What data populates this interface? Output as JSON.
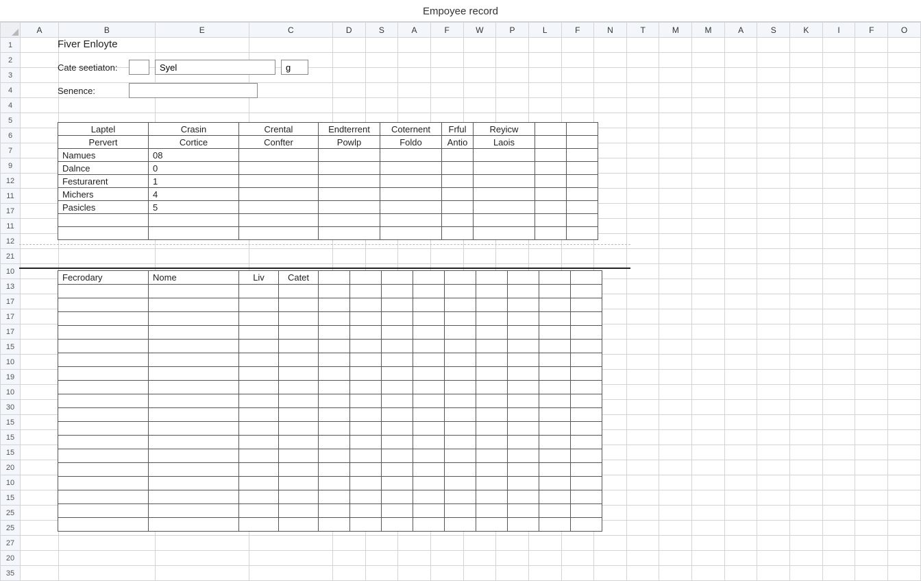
{
  "window": {
    "title": "Empoyee record"
  },
  "columns": [
    "A",
    "B",
    "E",
    "C",
    "D",
    "S",
    "A",
    "F",
    "W",
    "P",
    "L",
    "F",
    "N",
    "T",
    "M",
    "M",
    "A",
    "S",
    "K",
    "I",
    "F",
    "O"
  ],
  "row_numbers": [
    "1",
    "2",
    "3",
    "4",
    "4",
    "5",
    "6",
    "7",
    "9",
    "12",
    "11",
    "17",
    "11",
    "12",
    "21",
    "10",
    "13",
    "17",
    "17",
    "17",
    "15",
    "10",
    "19",
    "10",
    "30",
    "15",
    "15",
    "15",
    "20",
    "10",
    "15",
    "25",
    "25",
    "27",
    "20",
    "35"
  ],
  "form": {
    "title": "Fiver Enloyte",
    "label1": "Cate seetiaton:",
    "input1": "",
    "input2": "Syel",
    "input3": "g",
    "label2": "Senence:",
    "input4": ""
  },
  "table1": {
    "headers": [
      "Laptel",
      "Crasin",
      "Crental",
      "Endterrent",
      "Coternent",
      "Frful",
      "Reyicw",
      "",
      ""
    ],
    "sub": [
      "Pervert",
      "Cortice",
      "Confter",
      "Powlp",
      "Foldo",
      "Antio",
      "Laois",
      "",
      ""
    ],
    "rows": [
      [
        "Namues",
        "08",
        "",
        "",
        "",
        "",
        "",
        "",
        ""
      ],
      [
        "Dalnce",
        "0",
        "",
        "",
        "",
        "",
        "",
        "",
        ""
      ],
      [
        "Festurarent",
        "1",
        "",
        "",
        "",
        "",
        "",
        "",
        ""
      ],
      [
        "Michers",
        "4",
        "",
        "",
        "",
        "",
        "",
        "",
        ""
      ],
      [
        "Pasicles",
        "5",
        "",
        "",
        "",
        "",
        "",
        "",
        ""
      ],
      [
        "",
        "",
        "",
        "",
        "",
        "",
        "",
        "",
        ""
      ],
      [
        "",
        "",
        "",
        "",
        "",
        "",
        "",
        "",
        ""
      ]
    ]
  },
  "table2": {
    "headers": [
      "Fecrodary",
      "Nome",
      "Liv",
      "Catet",
      "",
      "",
      "",
      "",
      "",
      "",
      "",
      "",
      ""
    ]
  }
}
